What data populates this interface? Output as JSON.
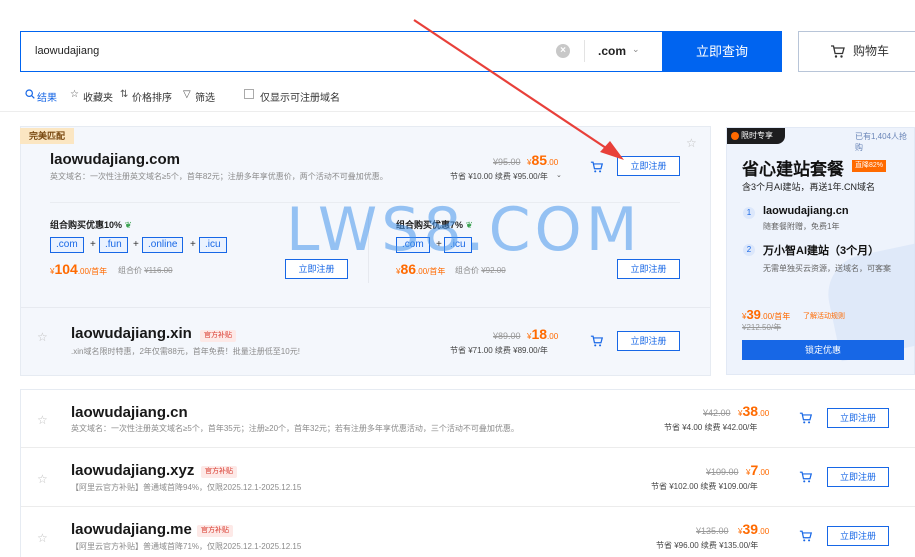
{
  "search": {
    "query": "laowudajiang",
    "clear_icon": "×",
    "tld": ".com",
    "button_label": "立即查询",
    "cart_label": "购物车"
  },
  "filters": {
    "result": "结果",
    "favorites": "收藏夹",
    "price_sort": "价格排序",
    "filter": "筛选",
    "only_available": "仅显示可注册域名"
  },
  "exact": {
    "badge": "完美匹配",
    "domain": "laowudajiang.com",
    "desc": "英文域名：一次性注册英文域名≥5个，首年82元；注册多年享优惠价，两个活动不可叠加优惠。",
    "old_price": "¥95.00",
    "price_symbol": "¥",
    "price": "85",
    "price_decimals": ".00",
    "saving": "节省 ¥10.00   续费 ¥95.00/年",
    "register": "立即注册"
  },
  "bundles": [
    {
      "title": "组合购买优惠10%",
      "tlds": [
        ".com",
        ".fun",
        ".online",
        ".icu"
      ],
      "price_symbol": "¥",
      "price": "104",
      "price_suffix": ".00/首年",
      "orig_label": "组合价",
      "orig_price": "¥116.00",
      "register": "立即注册"
    },
    {
      "title": "组合购买优惠7%",
      "tlds": [
        ".com",
        ".icu"
      ],
      "price_symbol": "¥",
      "price": "86",
      "price_suffix": ".00/首年",
      "orig_label": "组合价",
      "orig_price": "¥92.00",
      "register": "立即注册"
    }
  ],
  "xin": {
    "domain": "laowudajiang.xin",
    "tag": "官方补贴",
    "desc": ".xin域名限时特惠，2年仅需88元，首年免费！批量注册低至10元!",
    "old_price": "¥89.00",
    "price_symbol": "¥",
    "price": "18",
    "price_decimals": ".00",
    "saving": "节省 ¥71.00   续费 ¥89.00/年",
    "register": "立即注册"
  },
  "promo": {
    "tag": "限时专享",
    "sold": "已有1,404人抢购",
    "title": "省心建站套餐",
    "discount": "直降82%",
    "sub": "含3个月AI建站，再送1年.CN域名",
    "items": [
      {
        "num": "1",
        "title": "laowudajiang.cn",
        "desc": "随套餐附赠，免费1年"
      },
      {
        "num": "2",
        "title": "万小智AI建站（3个月）",
        "desc": "无需单独买云资源，送域名，可客案"
      }
    ],
    "price_symbol": "¥",
    "price": "39",
    "price_suffix": ".00/首年",
    "link": "了解活动规则",
    "orig": "¥212.50/年",
    "button": "锁定优惠"
  },
  "list": [
    {
      "domain": "laowudajiang.cn",
      "tag": "",
      "desc": "英文域名：一次性注册英文域名≥5个，首年35元；注册≥20个，首年32元；若有注册多年享优惠活动，三个活动不可叠加优惠。",
      "old_price": "¥42.00",
      "price_symbol": "¥",
      "price": "38",
      "price_decimals": ".00",
      "saving": "节省 ¥4.00   续费 ¥42.00/年",
      "register": "立即注册"
    },
    {
      "domain": "laowudajiang.xyz",
      "tag": "官方补贴",
      "desc": "【阿里云官方补贴】普通域首降94%，仅限2025.12.1-2025.12.15",
      "old_price": "¥109.00",
      "price_symbol": "¥",
      "price": "7",
      "price_decimals": ".00",
      "saving": "节省 ¥102.00   续费 ¥109.00/年",
      "register": "立即注册"
    },
    {
      "domain": "laowudajiang.me",
      "tag": "官方补贴",
      "desc": "【阿里云官方补贴】普通域首降71%，仅限2025.12.1-2025.12.15",
      "old_price": "¥135.00",
      "price_symbol": "¥",
      "price": "39",
      "price_decimals": ".00",
      "saving": "节省 ¥96.00   续费 ¥135.00/年",
      "register": "立即注册"
    }
  ],
  "watermark": "LWS8.COM",
  "colors": {
    "brand": "#0064f0",
    "price": "#ff6a00",
    "arrow": "#e8403a"
  }
}
